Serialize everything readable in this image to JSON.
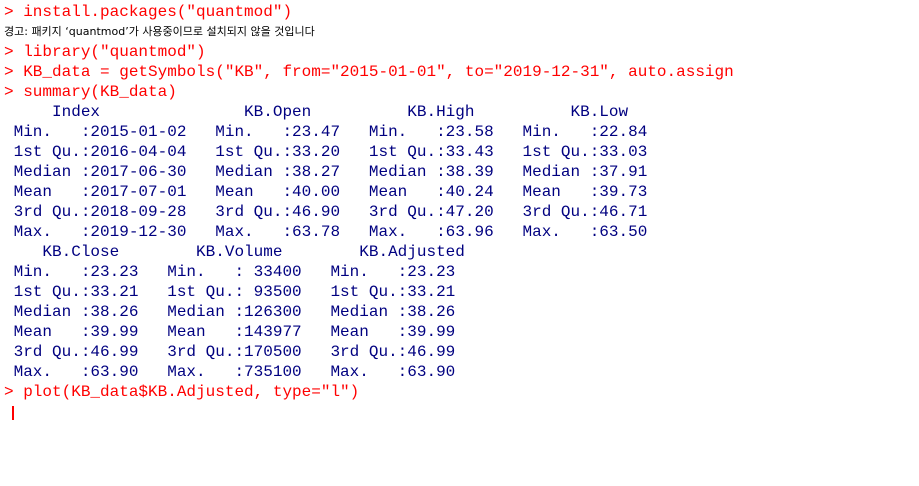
{
  "console": {
    "lines": [
      {
        "kind": "cmd",
        "text": "> install.packages(\"quantmod\")"
      },
      {
        "kind": "warn",
        "text": "경고: 패키지 ‘quantmod’가 사용중이므로 설치되지 않을 것입니다"
      },
      {
        "kind": "cmd",
        "text": "> library(\"quantmod\")"
      },
      {
        "kind": "cmd",
        "text": "> KB_data = getSymbols(\"KB\", from=\"2015-01-01\", to=\"2019-12-31\", auto.assign"
      },
      {
        "kind": "cmd",
        "text": "> summary(KB_data)"
      },
      {
        "kind": "out",
        "text": "     Index               KB.Open          KB.High          KB.Low     "
      },
      {
        "kind": "out",
        "text": " Min.   :2015-01-02   Min.   :23.47   Min.   :23.58   Min.   :22.84  "
      },
      {
        "kind": "out",
        "text": " 1st Qu.:2016-04-04   1st Qu.:33.20   1st Qu.:33.43   1st Qu.:33.03  "
      },
      {
        "kind": "out",
        "text": " Median :2017-06-30   Median :38.27   Median :38.39   Median :37.91  "
      },
      {
        "kind": "out",
        "text": " Mean   :2017-07-01   Mean   :40.00   Mean   :40.24   Mean   :39.73  "
      },
      {
        "kind": "out",
        "text": " 3rd Qu.:2018-09-28   3rd Qu.:46.90   3rd Qu.:47.20   3rd Qu.:46.71  "
      },
      {
        "kind": "out",
        "text": " Max.   :2019-12-30   Max.   :63.78   Max.   :63.96   Max.   :63.50  "
      },
      {
        "kind": "out",
        "text": "    KB.Close        KB.Volume        KB.Adjusted   "
      },
      {
        "kind": "out",
        "text": " Min.   :23.23   Min.   : 33400   Min.   :23.23  "
      },
      {
        "kind": "out",
        "text": " 1st Qu.:33.21   1st Qu.: 93500   1st Qu.:33.21  "
      },
      {
        "kind": "out",
        "text": " Median :38.26   Median :126300   Median :38.26  "
      },
      {
        "kind": "out",
        "text": " Mean   :39.99   Mean   :143977   Mean   :39.99  "
      },
      {
        "kind": "out",
        "text": " 3rd Qu.:46.99   3rd Qu.:170500   3rd Qu.:46.99  "
      },
      {
        "kind": "out",
        "text": " Max.   :63.90   Max.   :735100   Max.   :63.90  "
      },
      {
        "kind": "cmd",
        "text": "> plot(KB_data$KB.Adjusted, type=\"l\")"
      }
    ]
  },
  "colors": {
    "command": "#ff0000",
    "output": "#000080",
    "warning": "#000000",
    "background": "#ffffff",
    "cursor": "#ff0000"
  }
}
